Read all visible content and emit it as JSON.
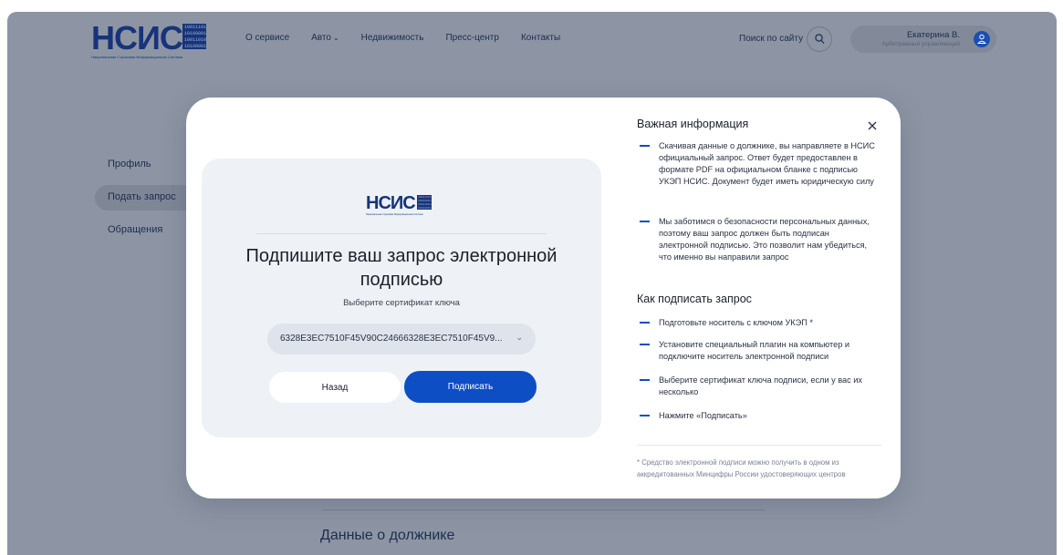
{
  "header": {
    "logo_text": "НСИС",
    "logo_bits": "10011101 10100001 10011010 10100001",
    "logo_subtitle": "Национальная Страховая Информационная Система",
    "nav": [
      {
        "label": "О сервисе"
      },
      {
        "label": "Авто"
      },
      {
        "label": "Недвижимость"
      },
      {
        "label": "Пресс-центр"
      },
      {
        "label": "Контакты"
      }
    ],
    "search_label": "Поиск по сайту",
    "user": {
      "name": "Екатерина В.",
      "role": "Арбитражный управляющий"
    }
  },
  "sidebar": {
    "items": [
      {
        "label": "Профиль"
      },
      {
        "label": "Подать запрос"
      },
      {
        "label": "Обращения"
      }
    ]
  },
  "page": {
    "section_title": "Данные о должнике"
  },
  "modal": {
    "card": {
      "title": "Подпишите ваш запрос электронной подписью",
      "subtitle": "Выберите сертификат ключа",
      "certificate_value": "6328E3EC7510F45V90C24666328E3EC7510F45V9...",
      "back_label": "Назад",
      "sign_label": "Подписать"
    },
    "info": {
      "heading_important": "Важная информация",
      "important_items": [
        "Скачивая данные о должнике, вы направляете в НСИС официальный запрос. Ответ будет предоставлен в формате PDF на официальном бланке с подписью УКЭП НСИС. Документ будет иметь юридическую силу",
        "Мы заботимся о безопасности персональных данных, поэтому ваш запрос должен быть подписан электронной подписью. Это позволит нам убедиться, что именно вы направили запрос"
      ],
      "heading_how": "Как подписать запрос",
      "how_items": [
        "Подготовьте носитель с ключом УКЭП *",
        "Установите специальный плагин на компьютер и подключите носитель электронной подписи",
        "Выберите сертификат ключа подписи, если у вас их несколько",
        "Нажмите «Подписать»"
      ],
      "footnote": "* Средство электронной подписи можно получить в одном из аккредитованных Минцифры России удостоверяющих центров"
    }
  },
  "colors": {
    "accent": "#0d4ec4",
    "overlay": "#8d95a4",
    "brand": "#17347a"
  }
}
